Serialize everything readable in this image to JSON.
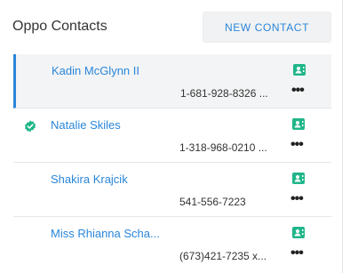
{
  "header": {
    "title": "Oppo Contacts",
    "new_contact_label": "NEW CONTACT"
  },
  "contacts": [
    {
      "name": "Kadin McGlynn II",
      "phone": "1-681-928-8326 ...",
      "selected": true,
      "verified": false
    },
    {
      "name": "Natalie Skiles",
      "phone": "1-318-968-0210 ...",
      "selected": false,
      "verified": true
    },
    {
      "name": "Shakira Krajcik",
      "phone": "541-556-7223",
      "selected": false,
      "verified": false
    },
    {
      "name": "Miss Rhianna Scha...",
      "phone": "(673)421-7235 x...",
      "selected": false,
      "verified": false
    }
  ],
  "icons": {
    "vcard": "contact-card-icon",
    "more": "more-options-icon",
    "verified": "verified-badge-icon"
  },
  "colors": {
    "accent": "#2a86d9",
    "vcard_green": "#20b68a",
    "selected_bg": "#f3f4f5"
  }
}
